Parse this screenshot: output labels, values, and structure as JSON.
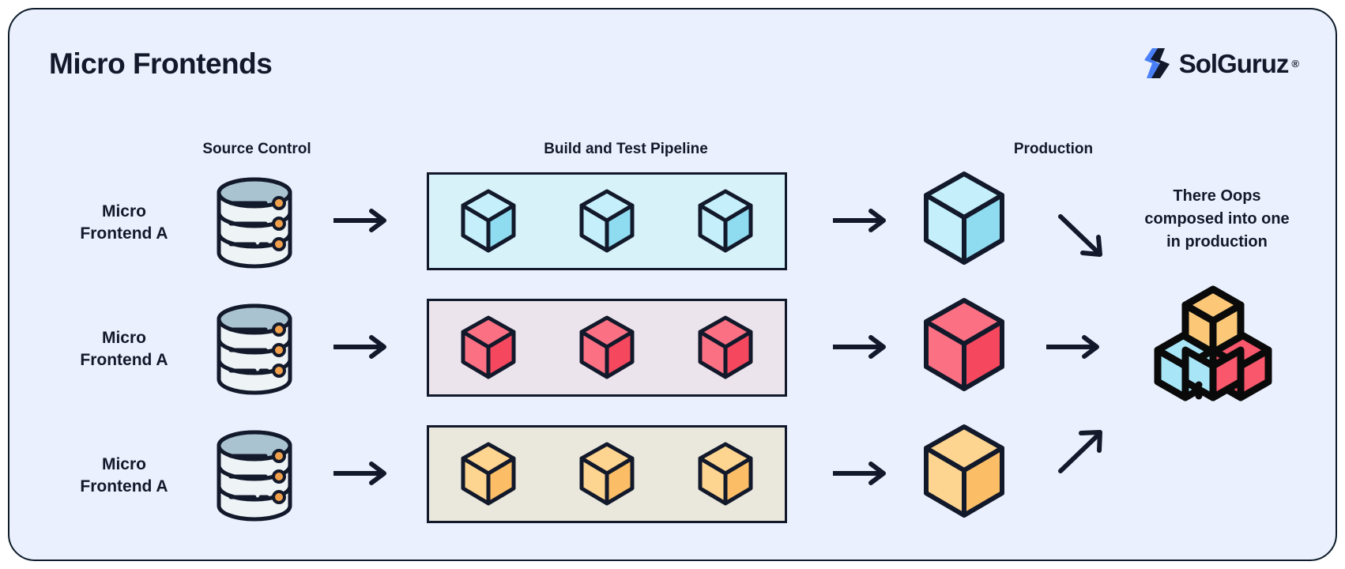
{
  "page": {
    "title": "Micro Frontends",
    "background": "#eaf0fd",
    "border_color": "#0d1b2a",
    "text_color": "#12192b"
  },
  "logo": {
    "name": "SolGuruz",
    "registered_mark": "®",
    "mark_icon": "solguruz-s-mark-icon",
    "accent_blue": "#4a80f7",
    "accent_dark": "#12192b"
  },
  "columns": [
    {
      "id": "source-control",
      "label": "Source Control"
    },
    {
      "id": "build-and-test-pipeline",
      "label": "Build and Test Pipeline"
    },
    {
      "id": "production",
      "label": "Production"
    }
  ],
  "rows": [
    {
      "id": "micro-frontend-a-blue",
      "label_line1": "Micro",
      "label_line2": "Frontend A",
      "repo_icon": "database-cylinder-icon",
      "cube_count": 3,
      "cube_color": "#a8e6f7",
      "cube_color_top": "#c5f0fb",
      "cube_color_side": "#8fdbef",
      "panel_background": "#d8f2fa",
      "arrow_icons": [
        "arrow-right-icon",
        "arrow-right-icon",
        "arrow-down-right-icon"
      ]
    },
    {
      "id": "micro-frontend-a-red",
      "label_line1": "Micro",
      "label_line2": "Frontend A",
      "repo_icon": "database-cylinder-icon",
      "cube_count": 3,
      "cube_color": "#f9576c",
      "cube_color_top": "#fb7183",
      "cube_color_side": "#f5475e",
      "panel_background": "#ece4ec",
      "arrow_icons": [
        "arrow-right-icon",
        "arrow-right-icon",
        "arrow-right-icon"
      ]
    },
    {
      "id": "micro-frontend-a-orange",
      "label_line1": "Micro",
      "label_line2": "Frontend A",
      "repo_icon": "database-cylinder-icon",
      "cube_count": 3,
      "cube_color": "#fcc878",
      "cube_color_top": "#fdd590",
      "cube_color_side": "#fbbe66",
      "panel_background": "#eae8dd",
      "arrow_icons": [
        "arrow-right-icon",
        "arrow-right-icon",
        "arrow-up-right-icon"
      ]
    }
  ],
  "composed_note": {
    "line1": "There Oops",
    "line2": "composed into one",
    "line3": "in production"
  },
  "cluster": {
    "icon": "three-cubes-cluster-icon",
    "top_cube_color": "#fcc878",
    "left_cube_color": "#a8e6f7",
    "right_cube_color": "#f9576c"
  },
  "database_icon": {
    "top_color": "#a9c3d1",
    "body_color": "#eef4f6",
    "dot_color": "#f0a04b",
    "stroke": "#12192b"
  }
}
